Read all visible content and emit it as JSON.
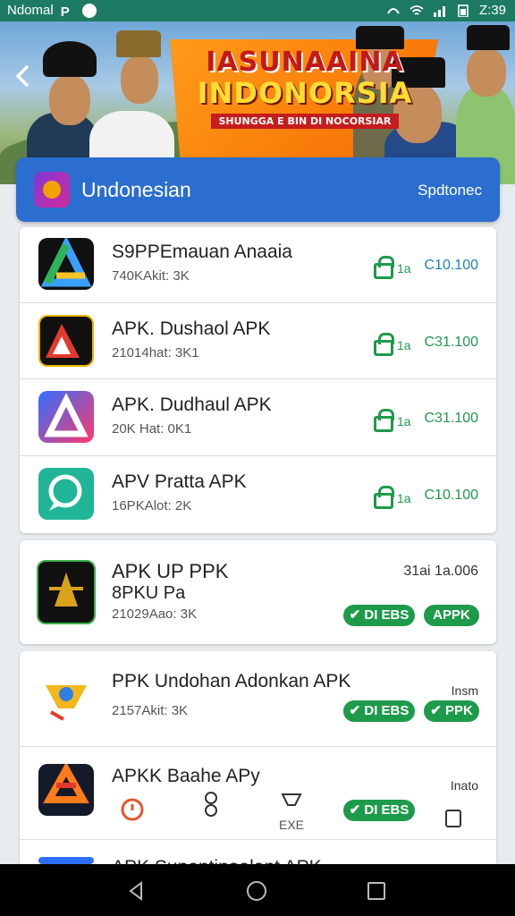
{
  "status_bar": {
    "left_text": "Ndomal",
    "time": "Z:39"
  },
  "banner": {
    "line1": "IASUNAAINA",
    "line2": "INDONORSIA",
    "line3": "SHUNGGA E BIN DI NOCORSIAR"
  },
  "header": {
    "title": "Undonesian",
    "right_label": "Spdtonec"
  },
  "list1": [
    {
      "name": "S9PPEmauan Anaaia",
      "meta": "740KAkit: 3K",
      "lock_mark": "1a",
      "price": "C10.100"
    },
    {
      "name": "APK. Dushaol APK",
      "meta": "21014hat: 3K1",
      "lock_mark": "1a",
      "price": "C31.100"
    },
    {
      "name": "APK. Dudhaul APK",
      "meta": "20K Hat: 0K1",
      "lock_mark": "1a",
      "price": "C31.100"
    },
    {
      "name": "APV Pratta APK",
      "meta": "16PKAlot: 2K",
      "lock_mark": "1a",
      "price": "C10.100"
    }
  ],
  "card2": {
    "name_line1": "APK UP PPK",
    "name_line2": "8PKU Pa",
    "meta": "21029Aao: 3K",
    "right_text": "31ai 1a.006",
    "pill1": "✔ DI EBS",
    "pill2": "APPK"
  },
  "list3": [
    {
      "name": "PPK Undohan Adonkan APK",
      "meta": "2157Akit: 3K",
      "right_text": "Insm",
      "pill1": "✔ DI EBS",
      "pill2": "✔ PPK"
    },
    {
      "name": "APKK Baahe APy",
      "meta": "",
      "right_text": "Inato",
      "pill1": "✔ DI EBS",
      "pill2": "",
      "sub_label": "EXE"
    }
  ],
  "partial_row": {
    "name": "APK Supentinaalant APK"
  },
  "colors": {
    "status_bar": "#1e7b63",
    "header": "#2b6ecf",
    "accent_green": "#1e9a4b"
  }
}
